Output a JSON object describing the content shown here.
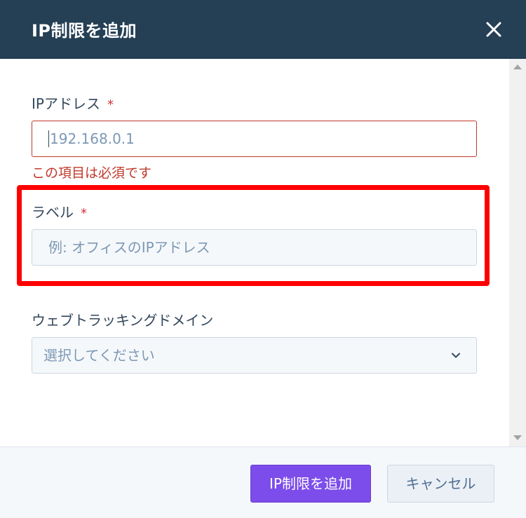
{
  "dialog": {
    "title": "IP制限を追加",
    "close_icon": "close-icon"
  },
  "form": {
    "ip_address": {
      "label": "IPアドレス",
      "required_mark": "*",
      "placeholder": "192.168.0.1",
      "error": "この項目は必須です"
    },
    "label_field": {
      "label": "ラベル",
      "required_mark": "*",
      "placeholder": "例: オフィスのIPアドレス"
    },
    "tracking_domain": {
      "label": "ウェブトラッキングドメイン",
      "placeholder": "選択してください",
      "icon": "chevron-down-icon"
    }
  },
  "footer": {
    "primary_label": "IP制限を追加",
    "secondary_label": "キャンセル"
  },
  "colors": {
    "header_bg": "#253f55",
    "primary": "#7c4dea",
    "error": "#c0392b",
    "highlight": "#ff0000"
  }
}
